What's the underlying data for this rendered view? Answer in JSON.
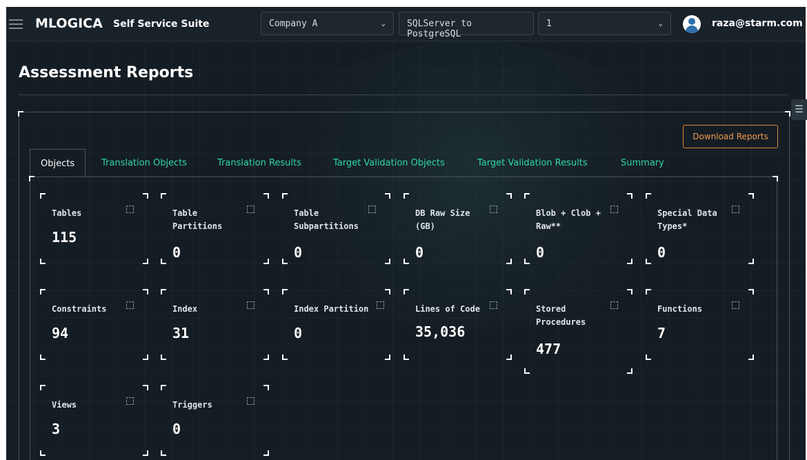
{
  "header": {
    "logo": "MLOGICA",
    "product": "Self Service Suite",
    "company_select": "Company A",
    "migration_select": "SQLServer to PostgreSQL",
    "run_select": "1",
    "user_email": "raza@starm.com"
  },
  "page": {
    "title": "Assessment Reports",
    "download_label": "Download Reports"
  },
  "tabs": [
    {
      "label": "Objects",
      "active": true
    },
    {
      "label": "Translation Objects"
    },
    {
      "label": "Translation Results"
    },
    {
      "label": "Target Validation Objects"
    },
    {
      "label": "Target Validation Results"
    },
    {
      "label": "Summary"
    }
  ],
  "cards": [
    {
      "label": "Tables",
      "value": "115"
    },
    {
      "label": "Table Partitions",
      "value": "0"
    },
    {
      "label": "Table Subpartitions",
      "value": "0"
    },
    {
      "label": "DB Raw Size (GB)",
      "value": "0"
    },
    {
      "label": "Blob + Clob + Raw**",
      "value": "0"
    },
    {
      "label": "Special Data Types*",
      "value": "0"
    },
    {
      "label": "Constraints",
      "value": "94"
    },
    {
      "label": "Index",
      "value": "31"
    },
    {
      "label": "Index Partition",
      "value": "0"
    },
    {
      "label": "Lines of Code",
      "value": "35,036"
    },
    {
      "label": "Stored Procedures",
      "value": "477"
    },
    {
      "label": "Functions",
      "value": "7"
    },
    {
      "label": "Views",
      "value": "3"
    },
    {
      "label": "Triggers",
      "value": "0"
    }
  ],
  "colors": {
    "accent_tab": "#2fd6a8",
    "download_border": "#e0873a",
    "background": "#151d24"
  }
}
